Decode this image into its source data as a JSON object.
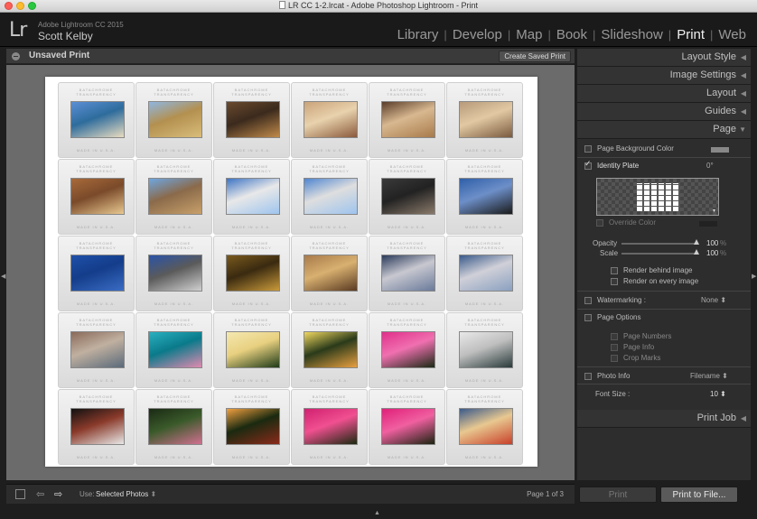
{
  "window": {
    "title": "LR CC 1-2.lrcat - Adobe Photoshop Lightroom - Print"
  },
  "identity": {
    "logo": "Lr",
    "product": "Adobe Lightroom CC 2015",
    "user": "Scott Kelby"
  },
  "modules": [
    "Library",
    "Develop",
    "Map",
    "Book",
    "Slideshow",
    "Print",
    "Web"
  ],
  "active_module": "Print",
  "toolbar_top": {
    "print_name": "Unsaved Print",
    "create_button": "Create Saved Print"
  },
  "slide_text": {
    "top_line1": "BATACHROME",
    "top_line2": "TRANSPARENCY",
    "bottom": "MADE IN U.S.A."
  },
  "photos": [
    {
      "subject": "beach",
      "colors": [
        "#5b8fd6",
        "#e9dcc0",
        "#2e6c9c"
      ]
    },
    {
      "subject": "building-facade",
      "colors": [
        "#8fb6e0",
        "#d9bd7a",
        "#b3904f"
      ]
    },
    {
      "subject": "hotel-lobby",
      "colors": [
        "#6a4a2e",
        "#c08a4a",
        "#3b2a1d"
      ]
    },
    {
      "subject": "hall-interior",
      "colors": [
        "#caa37a",
        "#8b5a3c",
        "#e8d2ad"
      ]
    },
    {
      "subject": "restaurant",
      "colors": [
        "#5a3d2a",
        "#a87a4a",
        "#d8b890"
      ]
    },
    {
      "subject": "dining-room",
      "colors": [
        "#b79a7a",
        "#7a5a3e",
        "#e2c9a3"
      ]
    },
    {
      "subject": "ornate-ceiling",
      "colors": [
        "#a86a3a",
        "#e8c890",
        "#7a4a2a"
      ]
    },
    {
      "subject": "casino-exterior",
      "colors": [
        "#6ea6e0",
        "#c8a06a",
        "#8a6a4a"
      ]
    },
    {
      "subject": "harbor-view",
      "colors": [
        "#3d74c4",
        "#9ec4ee",
        "#e8e8e8"
      ]
    },
    {
      "subject": "seaside-town",
      "colors": [
        "#4f86d0",
        "#9ec4ee",
        "#dedede"
      ]
    },
    {
      "subject": "couple-portrait",
      "colors": [
        "#3a3a3a",
        "#8a7a6a",
        "#222"
      ]
    },
    {
      "subject": "tower-sculpture",
      "colors": [
        "#2f5fa8",
        "#1a1a1a",
        "#6d8fc8"
      ]
    },
    {
      "subject": "lamp-sky",
      "colors": [
        "#1f4fa8",
        "#3a6cc4",
        "#143d8a"
      ]
    },
    {
      "subject": "balcony",
      "colors": [
        "#2b54a8",
        "#d0d0d0",
        "#5a5a5a"
      ]
    },
    {
      "subject": "brass-detail",
      "colors": [
        "#7a5a1e",
        "#c99a3a",
        "#3a2a10"
      ]
    },
    {
      "subject": "window-grille",
      "colors": [
        "#a87a4a",
        "#5a3a22",
        "#d8b070"
      ]
    },
    {
      "subject": "marina-night",
      "colors": [
        "#2a3a5a",
        "#6a7a9a",
        "#c8c8d0"
      ]
    },
    {
      "subject": "harbor-city",
      "colors": [
        "#3a5a8a",
        "#8aa0c0",
        "#d0d0d8"
      ]
    },
    {
      "subject": "street-hill",
      "colors": [
        "#8a6a5a",
        "#5a6a7a",
        "#c0b0a0"
      ]
    },
    {
      "subject": "turquoise-wall",
      "colors": [
        "#2ab0c0",
        "#e08ab0",
        "#0a7a8a"
      ]
    },
    {
      "subject": "yellow-rose",
      "colors": [
        "#f4e8b0",
        "#1e3a18",
        "#e8d080"
      ]
    },
    {
      "subject": "yellow-rose-2",
      "colors": [
        "#f0d860",
        "#e8a040",
        "#2a3a1a"
      ]
    },
    {
      "subject": "pink-rose",
      "colors": [
        "#e0308a",
        "#1a2a14",
        "#f070b0"
      ]
    },
    {
      "subject": "white-building",
      "colors": [
        "#e8e8e8",
        "#2a3a3a",
        "#bfbfbf"
      ]
    },
    {
      "subject": "window-black",
      "colors": [
        "#111111",
        "#e8e8e8",
        "#8a3a2a"
      ]
    },
    {
      "subject": "rose-bud",
      "colors": [
        "#1a2a14",
        "#d07090",
        "#3a5a2a"
      ]
    },
    {
      "subject": "peach-rose",
      "colors": [
        "#f0a040",
        "#8a2a1a",
        "#1a2a10"
      ]
    },
    {
      "subject": "magenta-rose",
      "colors": [
        "#d02070",
        "#1a2a10",
        "#f05090"
      ]
    },
    {
      "subject": "pink-rose-2",
      "colors": [
        "#e0207a",
        "#1a2410",
        "#f060a0"
      ]
    },
    {
      "subject": "boat",
      "colors": [
        "#3a5a8a",
        "#c8402a",
        "#e8c890"
      ]
    }
  ],
  "right_panel": {
    "sections": [
      "Layout Style",
      "Image Settings",
      "Layout",
      "Guides",
      "Page"
    ],
    "page": {
      "background_color": "Page Background Color",
      "identity_plate": "Identity Plate",
      "rotation": "0°",
      "override_color": "Override Color",
      "opacity_label": "Opacity",
      "opacity_value": "100",
      "opacity_fraction": 1.0,
      "scale_label": "Scale",
      "scale_value": "100",
      "scale_fraction": 1.0,
      "percent": "%",
      "render_behind": "Render behind image",
      "render_every": "Render on every image",
      "watermarking_label": "Watermarking :",
      "watermarking_value": "None",
      "page_options": "Page Options",
      "page_numbers": "Page Numbers",
      "page_info": "Page Info",
      "crop_marks": "Crop Marks",
      "photo_info": "Photo Info",
      "photo_info_value": "Filename",
      "font_size_label": "Font Size :",
      "font_size_value": "10"
    },
    "print_job": "Print Job"
  },
  "toolbar_bottom": {
    "use_label": "Use:",
    "use_value": "Selected Photos",
    "page_count": "Page 1 of 3"
  },
  "buttons": {
    "print": "Print",
    "print_to_file": "Print to File..."
  }
}
